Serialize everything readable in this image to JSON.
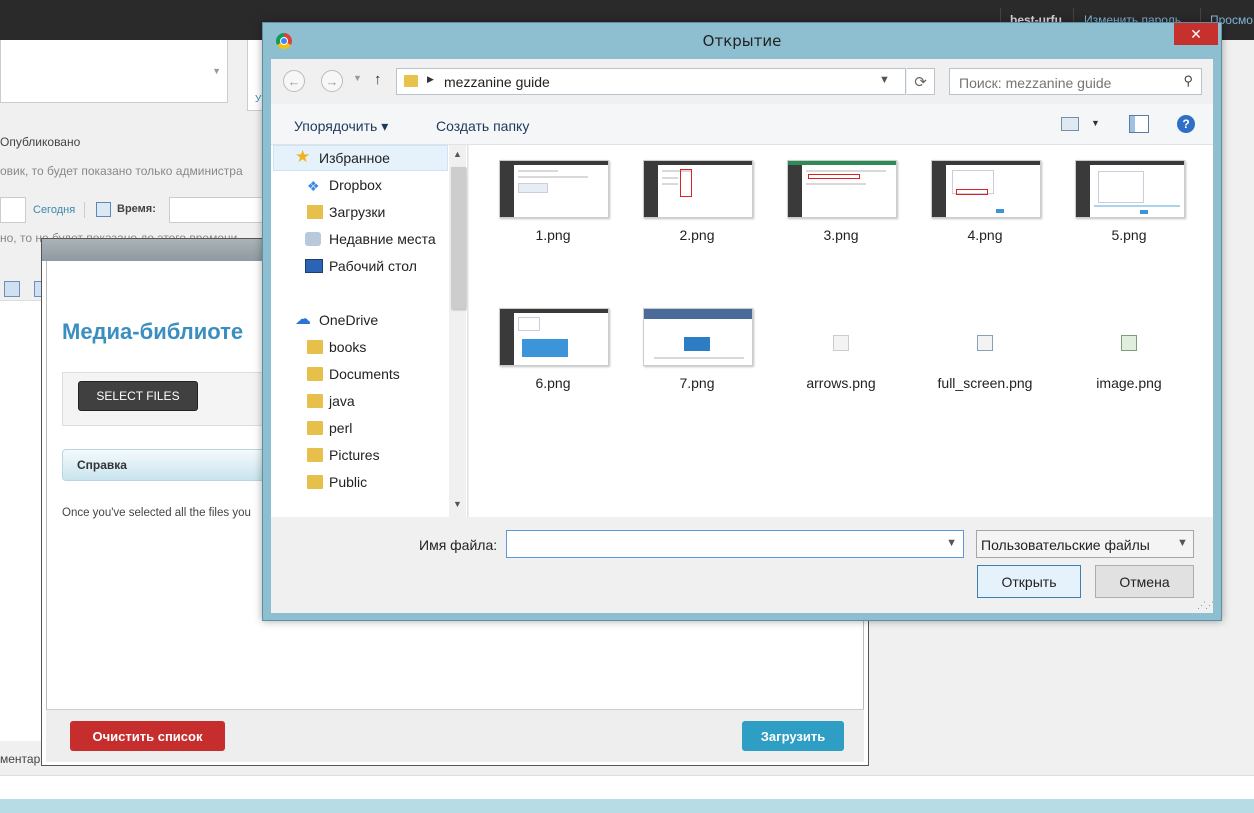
{
  "topbar": {
    "user": "best-urfu",
    "change_password": "Изменить пароль",
    "view": "Просмо"
  },
  "background": {
    "published": "Опубликовано",
    "hint_admin": "овик, то будет показано только администра",
    "today": "Сегодня",
    "time_label": "Время:",
    "hint_time": "но, то не будет показано до этого времени",
    "comment": "ментар",
    "panel_letter": "У"
  },
  "media": {
    "title": "Медиа-библиоте",
    "select_files": "SELECT FILES",
    "help_tab": "Справка",
    "description": "Once you've selected all the files you",
    "clear": "Очистить список",
    "upload": "Загрузить"
  },
  "dialog": {
    "title": "Открытие",
    "close_glyph": "✕",
    "address_path": "mezzanine guide",
    "search_placeholder": "Поиск: mezzanine guide",
    "organize": "Упорядочить ▾",
    "new_folder": "Создать папку",
    "help_glyph": "?",
    "tree": [
      {
        "label": "Избранное",
        "icon": "star-icon"
      },
      {
        "label": "Dropbox",
        "icon": "dropbox-icon"
      },
      {
        "label": "Загрузки",
        "icon": "downloads-icon"
      },
      {
        "label": "Недавние места",
        "icon": "recent-places-icon"
      },
      {
        "label": "Рабочий стол",
        "icon": "desktop-icon"
      },
      {
        "label": "OneDrive",
        "icon": "cloud-icon"
      },
      {
        "label": "books",
        "icon": "folder-icon"
      },
      {
        "label": "Documents",
        "icon": "folder-icon"
      },
      {
        "label": "java",
        "icon": "folder-icon"
      },
      {
        "label": "perl",
        "icon": "folder-icon"
      },
      {
        "label": "Pictures",
        "icon": "folder-icon"
      },
      {
        "label": "Public",
        "icon": "folder-icon"
      }
    ],
    "files": [
      {
        "name": "1.png"
      },
      {
        "name": "2.png"
      },
      {
        "name": "3.png"
      },
      {
        "name": "4.png"
      },
      {
        "name": "5.png"
      },
      {
        "name": "6.png"
      },
      {
        "name": "7.png"
      },
      {
        "name": "arrows.png"
      },
      {
        "name": "full_screen.png"
      },
      {
        "name": "image.png"
      }
    ],
    "filename_label": "Имя файла:",
    "filename_value": "",
    "filetype": "Пользовательские файлы",
    "open": "Открыть",
    "cancel": "Отмена"
  }
}
